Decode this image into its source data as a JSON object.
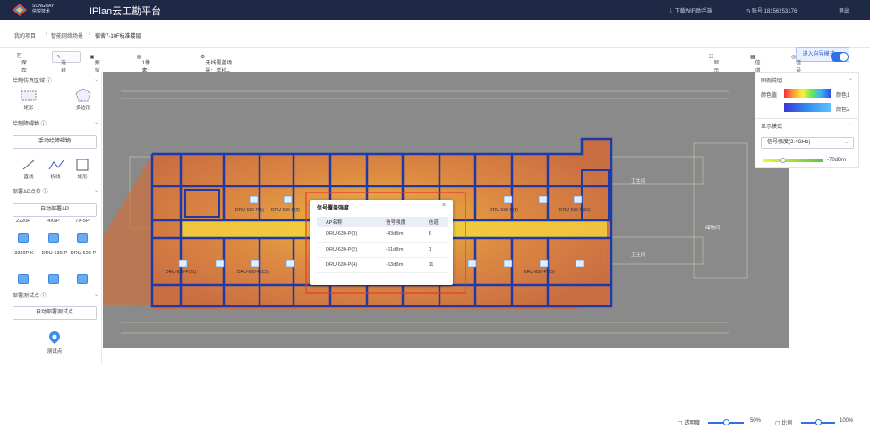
{
  "header": {
    "brand_top": "SUNGRAY",
    "brand_bottom": "信锐技术",
    "app_title": "IPlan云工勘平台",
    "download_wifi": "下载WiFi助手端",
    "account": "账号 18156253176",
    "logout": "退出"
  },
  "breadcrumb": {
    "items": [
      "我的项目",
      "智能网络场景",
      "宿舍7-10F标准楼层"
    ],
    "guide_button": "进入向导模式 >>"
  },
  "toolbar": {
    "save": "保存",
    "select": "选择",
    "preview": "预览视图",
    "scale": "1像素：0.0.2米",
    "scene": "无线覆盖场景：学校–宿舍楼(-65.5dBm)",
    "display_settings": "显示设置",
    "signal_list": "信道清单",
    "signal_heatmap": "信号仿真图"
  },
  "left_panel": {
    "sections": {
      "area": "绘制仿真区域",
      "obstacle": "绘制障碍物",
      "ap_deploy": "部署AP点位",
      "test_point": "部署测试点"
    },
    "area_tools": [
      "矩形",
      "多边形"
    ],
    "manual_obstacle_button": "手动绘障碍物",
    "obstacle_tools": [
      "直线",
      "折线",
      "矩形"
    ],
    "auto_ap_button": "自动部署AP",
    "ap_models": [
      "3320P-K",
      "DRU-630-P",
      "DRU-620-P"
    ],
    "ap_model_codes": [
      "2220P",
      "4X5P",
      "7X-5P"
    ],
    "auto_test_button": "自动部署测试点",
    "test_point_label": "测试点"
  },
  "canvas": {
    "room_labels": [
      "DRU-630-P(1)",
      "DRU-630-P(2)",
      "DRU-630-P(3)",
      "DRU-630-P(7)",
      "DRU-630-P(8)",
      "DRU-630-P(9)",
      "DRU-630-P(10)",
      "DRU-630-P(11)",
      "DRU-630-P(13)",
      "DRU-630-P(14)",
      "DRU-630-P(15)",
      "DRU-630-P(12)"
    ],
    "side_labels": [
      "卫生间",
      "储物间",
      "卫生间"
    ]
  },
  "popup": {
    "title": "信号覆盖强度",
    "close": "×",
    "columns": [
      "AP名称",
      "信号强度",
      "信道"
    ],
    "rows": [
      {
        "ap": "DRU-630-P(3)",
        "strength": "-43dBm",
        "channel": "6"
      },
      {
        "ap": "DRU-630-P(2)",
        "strength": "-61dBm",
        "channel": "1"
      },
      {
        "ap": "DRU-630-P(4)",
        "strength": "-63dBm",
        "channel": "11"
      }
    ]
  },
  "right_panel": {
    "legend_title": "图例说明",
    "legend_label_1": "颜色值",
    "legend_right_1": "颜色1",
    "legend_right_2": "颜色2",
    "display_mode_title": "显示模式",
    "mode_select": "信号强度(2.4GHz)",
    "threshold": "-70dBm"
  },
  "bottom": {
    "opacity_label": "透明度",
    "opacity_value": "50%",
    "scale_label": "比例",
    "scale_value": "100%"
  },
  "colors": {
    "topbar": "#1e2a45",
    "accent": "#2f6fe8",
    "wall": "#1f3aa8"
  }
}
